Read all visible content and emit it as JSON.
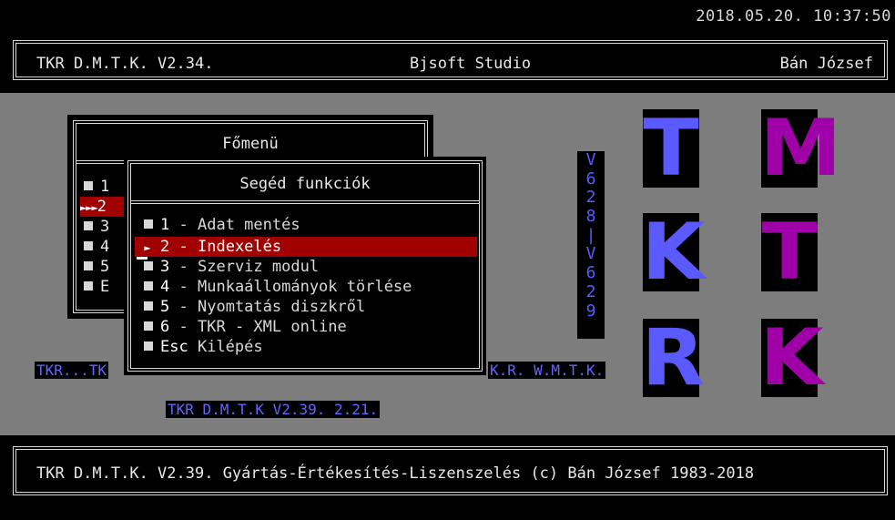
{
  "clock": "2018.05.20. 10:37:50",
  "header": {
    "left": "TKR D.M.T.K. V2.34.",
    "center": "Bjsoft Studio",
    "right": "Bán József"
  },
  "main_menu": {
    "title": "Főmenü",
    "items": [
      "1",
      "2",
      "3",
      "4",
      "5",
      "E"
    ],
    "pointer": "►►►"
  },
  "sub_menu": {
    "title": "Segéd funkciók",
    "items": [
      {
        "key": "1",
        "label": "Adat mentés"
      },
      {
        "key": "2",
        "label": "Indexelés",
        "selected": true
      },
      {
        "key": "3",
        "label": "Szerviz modul"
      },
      {
        "key": "4",
        "label": "Munkaállományok törlése"
      },
      {
        "key": "5",
        "label": "Nyomtatás diszkről"
      },
      {
        "key": "6",
        "label": "TKR - XML online"
      },
      {
        "key": "Esc",
        "label": "Kilépés"
      }
    ],
    "dash": "-",
    "selected_pointer": "►"
  },
  "vertical_text": [
    "V",
    "6",
    "2",
    "8",
    "|",
    "V",
    "6",
    "2",
    "9"
  ],
  "labels": {
    "left": "TKR...TK",
    "right": "K.R. W.M.T.K.",
    "center": "TKR D.M.T.K V2.39. 2.21."
  },
  "tiles": {
    "col1": [
      "T",
      "K",
      "R"
    ],
    "col2": [
      "M",
      "T",
      "K"
    ]
  },
  "colors": {
    "blue": "#5a5aff",
    "purple": "#a000a8",
    "selected": "#a00000",
    "desktop": "#7d7d7d"
  },
  "footer": "TKR D.M.T.K. V2.39. Gyártás-Értékesítés-Liszenszelés (c) Bán József 1983-2018"
}
